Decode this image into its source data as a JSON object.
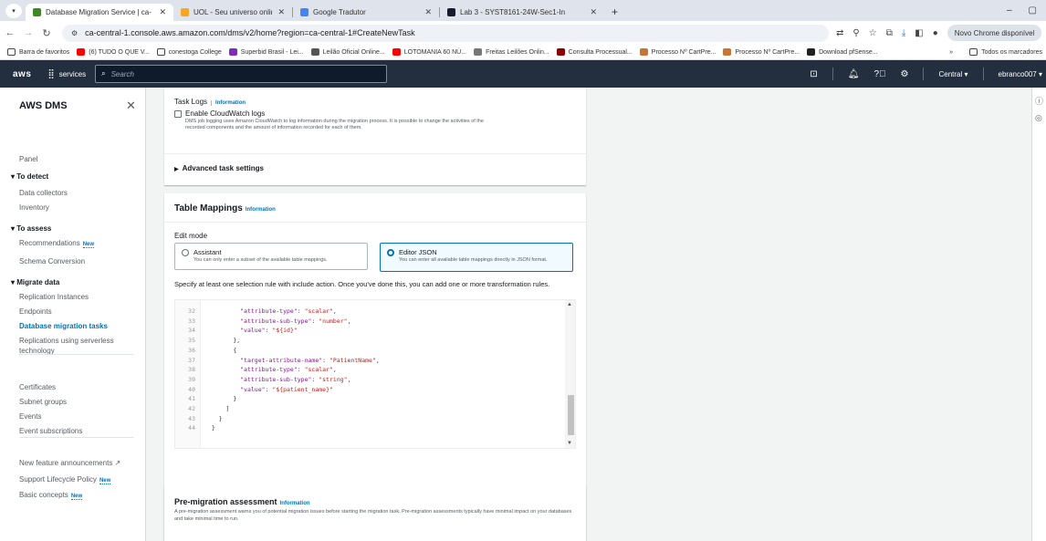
{
  "browser": {
    "tabs": [
      {
        "title": "Database Migration Service | ca-",
        "active": true,
        "favicon_color": "#3f8624"
      },
      {
        "title": "UOL - Seu universo online",
        "active": false,
        "favicon_color": "#f5a623"
      },
      {
        "title": "Google Tradutor",
        "active": false,
        "favicon_color": "#4285f4"
      },
      {
        "title": "Lab 3 - SYST8161-24W-Sec1-In",
        "active": false,
        "favicon_color": "#1a1a2e"
      }
    ],
    "url": "ca-central-1.console.aws.amazon.com/dms/v2/home?region=ca-central-1#CreateNewTask",
    "profile_pill": "Novo Chrome disponível",
    "bookmarks": [
      {
        "label": "Barra de favoritos",
        "icon": "folder-icon",
        "color": "#444444"
      },
      {
        "label": "(6) TUDO O QUE V...",
        "icon": "youtube-icon",
        "color": "#ff0000"
      },
      {
        "label": "conestoga College",
        "icon": "folder-icon",
        "color": "#444444"
      },
      {
        "label": "Superbid Brasil - Lei...",
        "icon": "superbid-icon",
        "color": "#7b2cbf"
      },
      {
        "label": "Leilão Oficial Online...",
        "icon": "leilao-icon",
        "color": "#555555"
      },
      {
        "label": "LOTOMANIA 60 NÚ...",
        "icon": "youtube-icon",
        "color": "#ff0000"
      },
      {
        "label": "Freitas Leilões Onlin...",
        "icon": "globe-icon",
        "color": "#777777"
      },
      {
        "label": "Consulta Processual...",
        "icon": "tribunal-icon",
        "color": "#8b0000"
      },
      {
        "label": "Processo Nº CartPre...",
        "icon": "processo-icon",
        "color": "#c87533"
      },
      {
        "label": "Processo Nº CartPre...",
        "icon": "processo-icon",
        "color": "#c87533"
      },
      {
        "label": "Download pfSense...",
        "icon": "pfsense-icon",
        "color": "#212121"
      }
    ],
    "bookmarks_more": "»",
    "all_bookmarks": "Todos os marcadores"
  },
  "aws_nav": {
    "logo": "aws",
    "services": "services",
    "search_placeholder": "Search",
    "region": "Central ▾",
    "account": "ebranco007 ▾"
  },
  "sidebar": {
    "title": "AWS DMS",
    "items": [
      {
        "label": "Panel",
        "type": "item"
      },
      {
        "label": "▾ To detect",
        "type": "section"
      },
      {
        "label": "Data collectors",
        "type": "item"
      },
      {
        "label": "Inventory",
        "type": "item"
      },
      {
        "label": "▾ To assess",
        "type": "section"
      },
      {
        "label": "Recommendations",
        "type": "item",
        "badge": "New"
      },
      {
        "label": "Schema Conversion",
        "type": "item"
      },
      {
        "label": "▾ Migrate data",
        "type": "section"
      },
      {
        "label": "Replication Instances",
        "type": "item"
      },
      {
        "label": "Endpoints",
        "type": "item"
      },
      {
        "label": "Database migration tasks",
        "type": "active"
      },
      {
        "label": "Replications using serverless",
        "type": "item"
      },
      {
        "label": "technology",
        "type": "item"
      },
      {
        "label": "Certificates",
        "type": "item"
      },
      {
        "label": "Subnet groups",
        "type": "item"
      },
      {
        "label": "Events",
        "type": "item"
      },
      {
        "label": "Event subscriptions",
        "type": "item"
      },
      {
        "label": "New feature announcements ↗",
        "type": "item"
      },
      {
        "label": "Support Lifecycle Policy",
        "type": "item",
        "badge": "New"
      },
      {
        "label": "Basic concepts",
        "type": "item",
        "badge": "New"
      }
    ]
  },
  "task_logs": {
    "heading": "Task Logs",
    "info": "Information",
    "checkbox_label": "Enable CloudWatch logs",
    "description": "DMS job logging uses Amazon CloudWatch to log information during the migration process. It is possible to change the activities of the recorded components and the amount of information recorded for each of them.",
    "advanced": "Advanced task settings"
  },
  "table_mappings": {
    "heading": "Table Mappings",
    "info": "Information",
    "edit_mode_label": "Edit mode",
    "options": [
      {
        "title": "Assistant",
        "desc": "You can only enter a subset of the available table mappings.",
        "selected": false
      },
      {
        "title": "Editor JSON",
        "desc": "You can enter all available table mappings directly in JSON format.",
        "selected": true
      }
    ],
    "instruction": "Specify at least one selection rule with include action. Once you've done this, you can add one or more transformation rules.",
    "code": [
      {
        "n": "32",
        "indent": "          ",
        "key": "\"attribute-type\"",
        "val": "\"scalar\"",
        "tail": ","
      },
      {
        "n": "33",
        "indent": "          ",
        "key": "\"attribute-sub-type\"",
        "val": "\"number\"",
        "tail": ","
      },
      {
        "n": "34",
        "indent": "          ",
        "key": "\"value\"",
        "val": "\"${id}\"",
        "tail": ""
      },
      {
        "n": "35",
        "indent": "        ",
        "key": "",
        "val": "",
        "tail": "},"
      },
      {
        "n": "36",
        "indent": "        ",
        "key": "",
        "val": "",
        "tail": "{"
      },
      {
        "n": "37",
        "indent": "          ",
        "key": "\"target-attribute-name\"",
        "val": "\"PatientName\"",
        "tail": ","
      },
      {
        "n": "38",
        "indent": "          ",
        "key": "\"attribute-type\"",
        "val": "\"scalar\"",
        "tail": ","
      },
      {
        "n": "39",
        "indent": "          ",
        "key": "\"attribute-sub-type\"",
        "val": "\"string\"",
        "tail": ","
      },
      {
        "n": "40",
        "indent": "          ",
        "key": "\"value\"",
        "val": "\"${patient_name}\"",
        "tail": ""
      },
      {
        "n": "41",
        "indent": "        ",
        "key": "",
        "val": "",
        "tail": "}"
      },
      {
        "n": "42",
        "indent": "      ",
        "key": "",
        "val": "",
        "tail": "]"
      },
      {
        "n": "43",
        "indent": "    ",
        "key": "",
        "val": "",
        "tail": "}"
      },
      {
        "n": "44",
        "indent": "  ",
        "key": "",
        "val": "",
        "tail": "}"
      }
    ]
  },
  "pre_migration": {
    "heading": "Pre-migration assessment",
    "info": "Information",
    "description": "A pre-migration assessment warns you of potential migration issues before starting the migration task. Pre-migration assessments typically have minimal impact on your databases and take minimal time to run."
  }
}
